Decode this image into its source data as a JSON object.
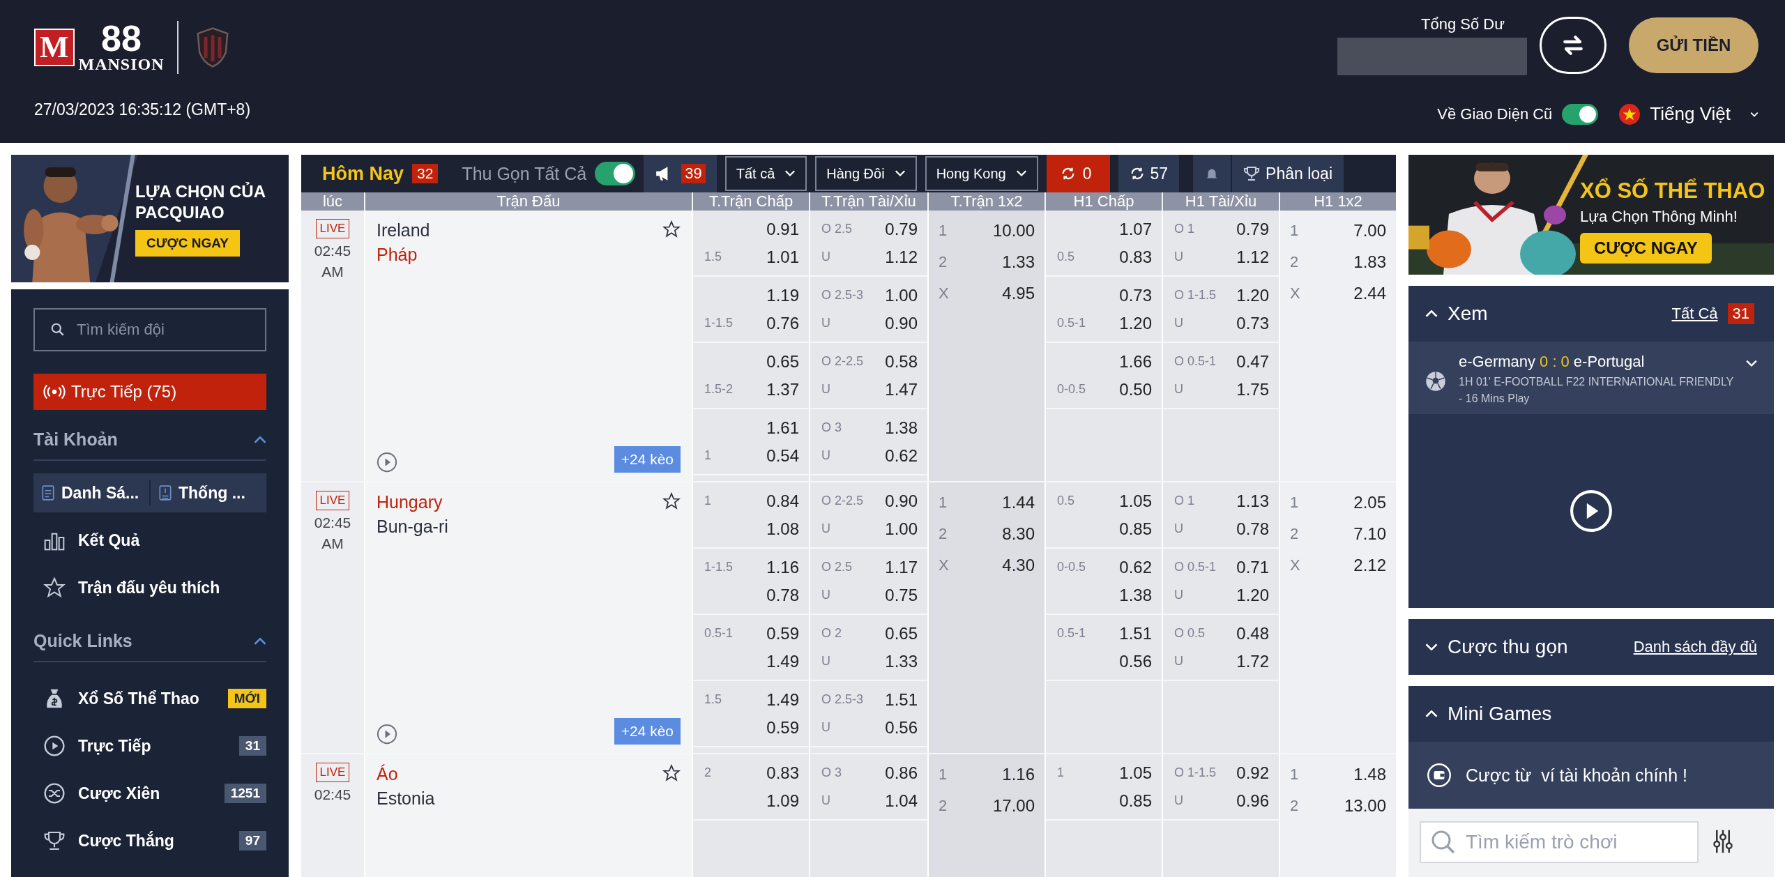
{
  "header": {
    "logo": {
      "mark": "M",
      "number": "88",
      "name": "MANSION"
    },
    "datetime": "27/03/2023 16:35:12 (GMT+8)",
    "balance_label": "Tổng Số Dư",
    "deposit_button": "GỬI TIỀN",
    "old_ui": {
      "label": "Về Giao Diện Cũ",
      "on": true
    },
    "language": "Tiếng Việt"
  },
  "left_banner": {
    "headline": "LỰA CHỌN CỦA PACQUIAO",
    "cta": "CƯỢC NGAY"
  },
  "sidebar": {
    "search": {
      "placeholder": "Tìm kiếm đội"
    },
    "live_button": "Trực Tiếp (75)",
    "sections": [
      {
        "title": "Tài Khoản",
        "expanded": true,
        "tabs": [
          {
            "kind": "list",
            "label": "Danh Sá..."
          },
          {
            "kind": "statement",
            "label": "Thống ..."
          }
        ],
        "items": [
          {
            "kind": "results",
            "label": "Kết Quả"
          },
          {
            "kind": "favorites",
            "label": "Trận đấu yêu thích"
          }
        ]
      },
      {
        "title": "Quick Links",
        "expanded": true,
        "items": [
          {
            "kind": "lottery",
            "label": "Xổ Số Thể Thao",
            "badge": "MỚI",
            "highlight": true
          },
          {
            "kind": "live",
            "label": "Trực Tiếp",
            "badge": "31",
            "highlight": false
          },
          {
            "kind": "parlay",
            "label": "Cược Xiên",
            "badge": "1251",
            "highlight": false
          },
          {
            "kind": "outright",
            "label": "Cược Thắng",
            "badge": "97",
            "highlight": false
          }
        ]
      }
    ]
  },
  "toolbar": {
    "title": "Hôm Nay",
    "count": "32",
    "collapse": {
      "label": "Thu Gọn Tất Cả",
      "on": true
    },
    "announcements": "39",
    "filters": [
      "Tất cả",
      "Hàng Đôi",
      "Hong Kong"
    ],
    "pending": "0",
    "refresh": "57",
    "sort": "Phân loại"
  },
  "columns": [
    "lúc",
    "Trận Đấu",
    "T.Trận Chấp",
    "T.Trận Tài/Xỉu",
    "T.Trận 1x2",
    "H1 Chấp",
    "H1 Tài/Xỉu",
    "H1 1x2"
  ],
  "matches": [
    {
      "status": "LIVE",
      "time": "02:45",
      "ampm": "AM",
      "teams": [
        {
          "name": "Ireland",
          "highlight": false
        },
        {
          "name": "Pháp",
          "highlight": true
        }
      ],
      "more": "+24 kèo",
      "markets": [
        {
          "kind": "handicap",
          "lines": [
            {
              "rows": [
                {
                  "odds": "0.91"
                },
                {
                  "label": "1.5",
                  "odds": "1.01"
                }
              ]
            },
            {
              "rows": [
                {
                  "odds": "1.19"
                },
                {
                  "label": "1-1.5",
                  "odds": "0.76"
                }
              ]
            },
            {
              "rows": [
                {
                  "odds": "0.65"
                },
                {
                  "label": "1.5-2",
                  "odds": "1.37"
                }
              ]
            },
            {
              "rows": [
                {
                  "odds": "1.61"
                },
                {
                  "label": "1",
                  "odds": "0.54"
                }
              ]
            }
          ]
        },
        {
          "kind": "total",
          "lines": [
            {
              "rows": [
                {
                  "label": "O 2.5",
                  "odds": "0.79"
                },
                {
                  "label": "U",
                  "odds": "1.12"
                }
              ]
            },
            {
              "rows": [
                {
                  "label": "O 2.5-3",
                  "odds": "1.00"
                },
                {
                  "label": "U",
                  "odds": "0.90"
                }
              ]
            },
            {
              "rows": [
                {
                  "label": "O 2-2.5",
                  "odds": "0.58"
                },
                {
                  "label": "U",
                  "odds": "1.47"
                }
              ]
            },
            {
              "rows": [
                {
                  "label": "O 3",
                  "odds": "1.38"
                },
                {
                  "label": "U",
                  "odds": "0.62"
                }
              ]
            }
          ]
        },
        {
          "kind": "threeway",
          "outcomes": [
            {
              "label": "1",
              "odds": "10.00"
            },
            {
              "label": "2",
              "odds": "1.33"
            },
            {
              "label": "X",
              "odds": "4.95"
            }
          ]
        },
        {
          "kind": "handicap",
          "lines": [
            {
              "rows": [
                {
                  "odds": "1.07"
                },
                {
                  "label": "0.5",
                  "odds": "0.83"
                }
              ]
            },
            {
              "rows": [
                {
                  "odds": "0.73"
                },
                {
                  "label": "0.5-1",
                  "odds": "1.20"
                }
              ]
            },
            {
              "rows": [
                {
                  "odds": "1.66"
                },
                {
                  "label": "0-0.5",
                  "odds": "0.50"
                }
              ]
            }
          ]
        },
        {
          "kind": "total",
          "lines": [
            {
              "rows": [
                {
                  "label": "O 1",
                  "odds": "0.79"
                },
                {
                  "label": "U",
                  "odds": "1.12"
                }
              ]
            },
            {
              "rows": [
                {
                  "label": "O 1-1.5",
                  "odds": "1.20"
                },
                {
                  "label": "U",
                  "odds": "0.73"
                }
              ]
            },
            {
              "rows": [
                {
                  "label": "O 0.5-1",
                  "odds": "0.47"
                },
                {
                  "label": "U",
                  "odds": "1.75"
                }
              ]
            }
          ]
        },
        {
          "kind": "threeway",
          "outcomes": [
            {
              "label": "1",
              "odds": "7.00"
            },
            {
              "label": "2",
              "odds": "1.83"
            },
            {
              "label": "X",
              "odds": "2.44"
            }
          ]
        }
      ]
    },
    {
      "status": "LIVE",
      "time": "02:45",
      "ampm": "AM",
      "teams": [
        {
          "name": "Hungary",
          "highlight": true
        },
        {
          "name": "Bun-ga-ri",
          "highlight": false
        }
      ],
      "more": "+24 kèo",
      "markets": [
        {
          "kind": "handicap",
          "lines": [
            {
              "rows": [
                {
                  "label": "1",
                  "odds": "0.84"
                },
                {
                  "odds": "1.08"
                }
              ]
            },
            {
              "rows": [
                {
                  "label": "1-1.5",
                  "odds": "1.16"
                },
                {
                  "odds": "0.78"
                }
              ]
            },
            {
              "rows": [
                {
                  "label": "0.5-1",
                  "odds": "0.59"
                },
                {
                  "odds": "1.49"
                }
              ]
            },
            {
              "rows": [
                {
                  "label": "1.5",
                  "odds": "1.49"
                },
                {
                  "odds": "0.59"
                }
              ]
            }
          ]
        },
        {
          "kind": "total",
          "lines": [
            {
              "rows": [
                {
                  "label": "O 2-2.5",
                  "odds": "0.90"
                },
                {
                  "label": "U",
                  "odds": "1.00"
                }
              ]
            },
            {
              "rows": [
                {
                  "label": "O 2.5",
                  "odds": "1.17"
                },
                {
                  "label": "U",
                  "odds": "0.75"
                }
              ]
            },
            {
              "rows": [
                {
                  "label": "O 2",
                  "odds": "0.65"
                },
                {
                  "label": "U",
                  "odds": "1.33"
                }
              ]
            },
            {
              "rows": [
                {
                  "label": "O 2.5-3",
                  "odds": "1.51"
                },
                {
                  "label": "U",
                  "odds": "0.56"
                }
              ]
            }
          ]
        },
        {
          "kind": "threeway",
          "outcomes": [
            {
              "label": "1",
              "odds": "1.44"
            },
            {
              "label": "2",
              "odds": "8.30"
            },
            {
              "label": "X",
              "odds": "4.30"
            }
          ]
        },
        {
          "kind": "handicap",
          "lines": [
            {
              "rows": [
                {
                  "label": "0.5",
                  "odds": "1.05"
                },
                {
                  "odds": "0.85"
                }
              ]
            },
            {
              "rows": [
                {
                  "label": "0-0.5",
                  "odds": "0.62"
                },
                {
                  "odds": "1.38"
                }
              ]
            },
            {
              "rows": [
                {
                  "label": "0.5-1",
                  "odds": "1.51"
                },
                {
                  "odds": "0.56"
                }
              ]
            }
          ]
        },
        {
          "kind": "total",
          "lines": [
            {
              "rows": [
                {
                  "label": "O 1",
                  "odds": "1.13"
                },
                {
                  "label": "U",
                  "odds": "0.78"
                }
              ]
            },
            {
              "rows": [
                {
                  "label": "O 0.5-1",
                  "odds": "0.71"
                },
                {
                  "label": "U",
                  "odds": "1.20"
                }
              ]
            },
            {
              "rows": [
                {
                  "label": "O 0.5",
                  "odds": "0.48"
                },
                {
                  "label": "U",
                  "odds": "1.72"
                }
              ]
            }
          ]
        },
        {
          "kind": "threeway",
          "outcomes": [
            {
              "label": "1",
              "odds": "2.05"
            },
            {
              "label": "2",
              "odds": "7.10"
            },
            {
              "label": "X",
              "odds": "2.12"
            }
          ]
        }
      ]
    },
    {
      "status": "LIVE",
      "time": "02:45",
      "teams": [
        {
          "name": "Áo",
          "highlight": true
        },
        {
          "name": "Estonia",
          "highlight": false
        }
      ],
      "markets": [
        {
          "kind": "handicap",
          "lines": [
            {
              "rows": [
                {
                  "label": "2",
                  "odds": "0.83"
                },
                {
                  "odds": "1.09"
                }
              ]
            }
          ]
        },
        {
          "kind": "total",
          "lines": [
            {
              "rows": [
                {
                  "label": "O 3",
                  "odds": "0.86"
                },
                {
                  "label": "U",
                  "odds": "1.04"
                }
              ]
            }
          ]
        },
        {
          "kind": "threeway",
          "outcomes": [
            {
              "label": "1",
              "odds": "1.16"
            },
            {
              "label": "2",
              "odds": "17.00"
            }
          ]
        },
        {
          "kind": "handicap",
          "lines": [
            {
              "rows": [
                {
                  "label": "1",
                  "odds": "1.05"
                },
                {
                  "odds": "0.85"
                }
              ]
            }
          ]
        },
        {
          "kind": "total",
          "lines": [
            {
              "rows": [
                {
                  "label": "O 1-1.5",
                  "odds": "0.92"
                },
                {
                  "label": "U",
                  "odds": "0.96"
                }
              ]
            }
          ]
        },
        {
          "kind": "threeway",
          "outcomes": [
            {
              "label": "1",
              "odds": "1.48"
            },
            {
              "label": "2",
              "odds": "13.00"
            }
          ]
        }
      ]
    }
  ],
  "right_banner": {
    "headline": "XỔ SỐ THỂ THAO",
    "subline": "Lựa Chọn Thông Minh!",
    "cta": "CƯỢC NGAY"
  },
  "watch": {
    "title": "Xem",
    "expanded": true,
    "link": "Tất Cả",
    "count": "31",
    "match": {
      "home": "e-Germany",
      "score": "0 : 0",
      "away": "e-Portugal",
      "info": "1H 01' E-FOOTBALL F22 INTERNATIONAL FRIENDLY - 16 Mins Play"
    }
  },
  "bet_slip": {
    "title": "Cược thu gọn",
    "expanded": false,
    "link": "Danh sách đầy đủ"
  },
  "mini_games": {
    "title": "Mini Games",
    "expanded": true,
    "wallet": "Cược từ  ví tài khoản chính !",
    "search": {
      "placeholder": "Tìm kiếm trò chơi"
    }
  }
}
